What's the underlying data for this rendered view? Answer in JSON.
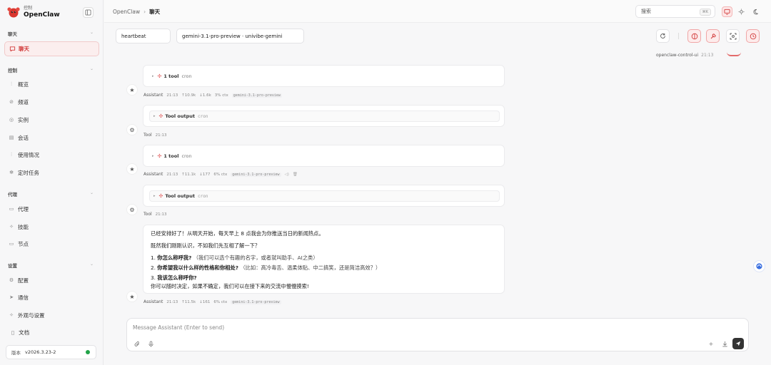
{
  "brand": {
    "sub": "控制",
    "name": "OpenClaw"
  },
  "sidebar": {
    "sections": [
      {
        "label": "聊天",
        "items": [
          {
            "label": "聊天",
            "icon": "chat-icon",
            "active": true
          }
        ]
      },
      {
        "label": "控制",
        "items": [
          {
            "label": "概览",
            "icon": "chart-icon"
          },
          {
            "label": "频道",
            "icon": "link-icon"
          },
          {
            "label": "实例",
            "icon": "broadcast-icon"
          },
          {
            "label": "会话",
            "icon": "document-icon"
          },
          {
            "label": "使用情况",
            "icon": "bar-chart-icon"
          },
          {
            "label": "定时任务",
            "icon": "loading-icon"
          }
        ]
      },
      {
        "label": "代理",
        "items": [
          {
            "label": "代理",
            "icon": "folder-icon"
          },
          {
            "label": "技能",
            "icon": "sparkle-icon"
          },
          {
            "label": "节点",
            "icon": "monitor-icon"
          }
        ]
      },
      {
        "label": "设置",
        "items": [
          {
            "label": "配置",
            "icon": "gear-icon"
          },
          {
            "label": "通信",
            "icon": "send-icon"
          },
          {
            "label": "外观与设置",
            "icon": "sparkle-icon"
          }
        ]
      }
    ],
    "docs": "文档",
    "version_label": "版本",
    "version": "v2026.3.23-2"
  },
  "topbar": {
    "crumb_root": "OpenClaw",
    "crumb_sep": "›",
    "crumb_current": "聊天",
    "search_placeholder": "搜索",
    "search_kbd": "⌘K"
  },
  "toolbar": {
    "session": "heartbeat",
    "model": "gemini-3.1-pro-preview · univibe-gemini"
  },
  "chat": {
    "user_meta": {
      "name": "openclaw-control-ui",
      "time": "21:13"
    },
    "messages": [
      {
        "kind": "assistant-tool",
        "tool_label": "1 tool",
        "tool_name": "cron",
        "role": "Assistant",
        "time": "21:13",
        "stats": [
          "↑10.9k",
          "↓1.6k",
          "3% ctx"
        ],
        "model": "gemini-3.1-pro-preview"
      },
      {
        "kind": "tool-output",
        "tool_label": "Tool output",
        "tool_name": "cron",
        "role": "Tool",
        "time": "21:13"
      },
      {
        "kind": "assistant-tool",
        "tool_label": "1 tool",
        "tool_name": "cron",
        "role": "Assistant",
        "time": "21:13",
        "stats": [
          "↑11.1k",
          "↓177",
          "6% ctx"
        ],
        "model": "gemini-3.1-pro-preview"
      },
      {
        "kind": "tool-output",
        "tool_label": "Tool output",
        "tool_name": "cron",
        "role": "Tool",
        "time": "21:13"
      },
      {
        "kind": "assistant-text",
        "role": "Assistant",
        "time": "21:13",
        "stats": [
          "↑11.5k",
          "↓161",
          "6% ctx"
        ],
        "model": "gemini-3.1-pro-preview",
        "lines": {
          "l1": "已经安排好了！从明天开始，每天早上 8 点我会为你推送当日的新闻热点。",
          "l2": "既然我们刚刚认识，不如我们先互相了解一下？",
          "q1_num": "1.",
          "q1_bold": "你怎么称呼我?",
          "q1_rest": "（我们可以选个有趣的名字，或者就叫助手、AI之类）",
          "q2_num": "2.",
          "q2_bold": "你希望我以什么样的性格和你相处?",
          "q2_rest": "（比如：高冷毒舌、温柔体贴、中二搞笑，还是简洁高效？）",
          "q3_num": "3.",
          "q3_bold": "我该怎么称呼你?",
          "l_end": "你可以随时决定，如果不确定，我们可以在接下来的交流中慢慢摸索!"
        }
      }
    ]
  },
  "composer": {
    "placeholder": "Message Assistant (Enter to send)"
  },
  "colors": {
    "accent": "#d23b3b",
    "accent_bg": "#fdecec",
    "online": "#22a348"
  }
}
